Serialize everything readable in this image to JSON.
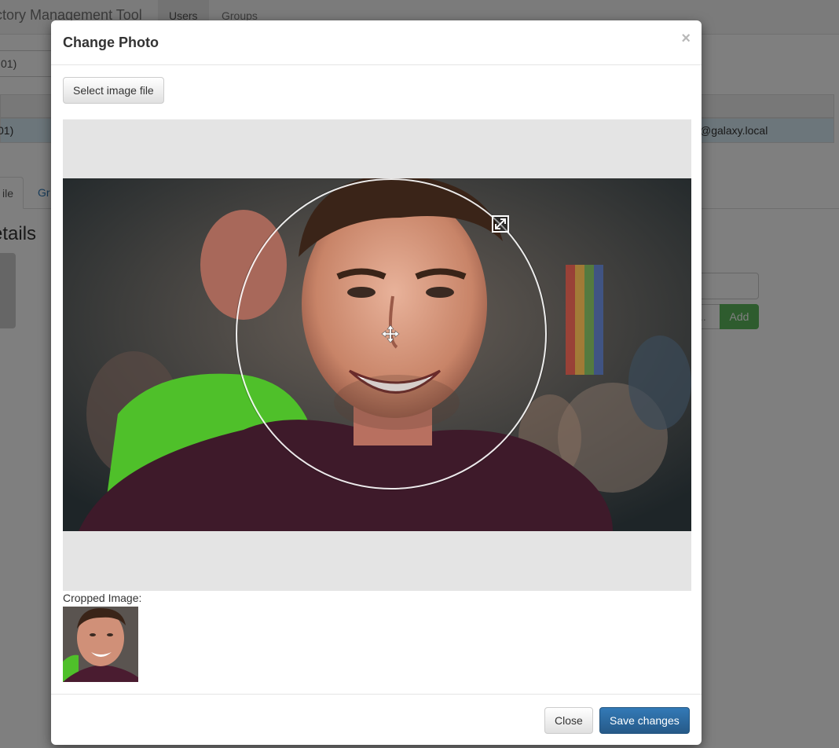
{
  "background": {
    "brand": "ctory Management Tool",
    "nav_tabs": [
      "Users",
      "Groups"
    ],
    "search_value": "01)",
    "selected_row": {
      "left_text": "01)",
      "right_text": "@galaxy.local"
    },
    "profile_tabs": [
      "ile",
      "Gr"
    ],
    "details_heading": "etails",
    "add_input_placeholder": "..",
    "add_button": "Add"
  },
  "modal": {
    "title": "Change Photo",
    "close_symbol": "×",
    "select_file_button": "Select image file",
    "cropped_label": "Cropped Image:",
    "footer": {
      "close_button": "Close",
      "save_button": "Save changes"
    }
  },
  "colors": {
    "primary": "#337ab7",
    "success": "#5cb85c",
    "crop_background": "#e4e4e4"
  },
  "icons": {
    "move": "move-arrows-icon",
    "resize": "expand-arrows-icon"
  }
}
